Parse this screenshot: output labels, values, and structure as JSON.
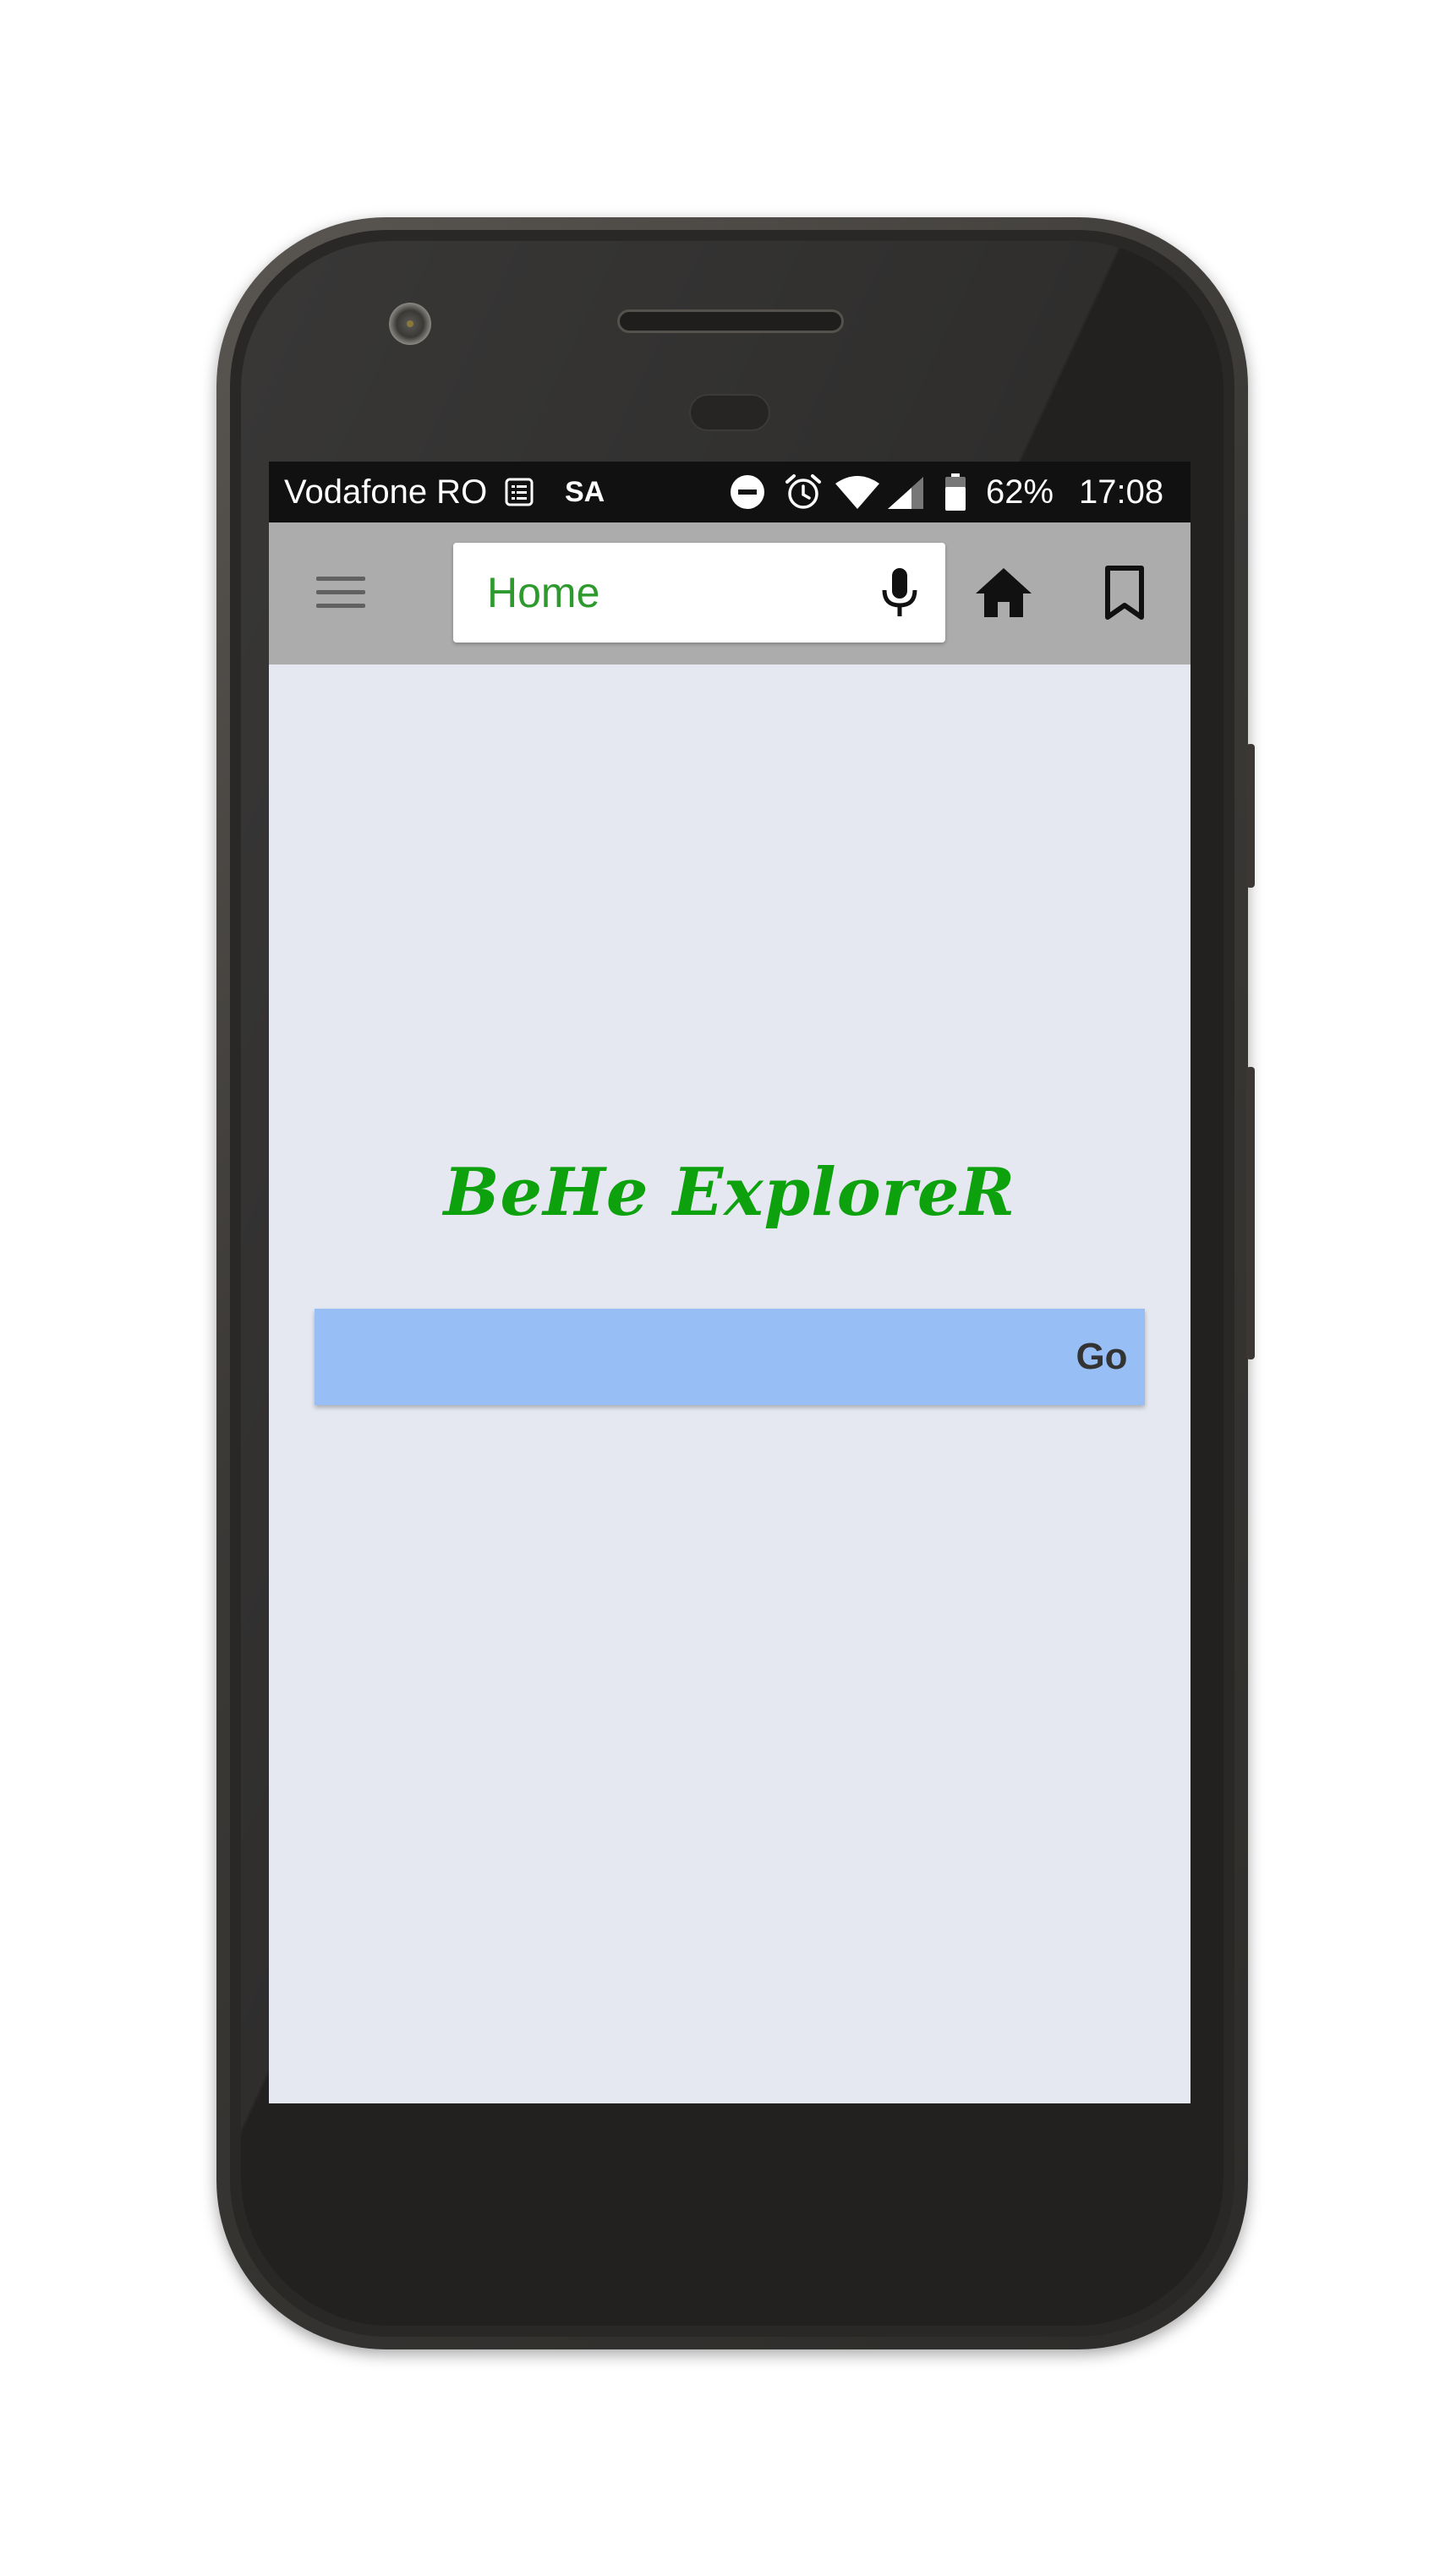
{
  "status_bar": {
    "carrier": "Vodafone RO",
    "sa_label": "SA",
    "battery": "62%",
    "time": "17:08",
    "icons": [
      "sim-list-icon",
      "dnd-icon",
      "alarm-icon",
      "wifi-icon",
      "signal-icon",
      "battery-icon"
    ]
  },
  "toolbar": {
    "menu_icon": "hamburger-menu-icon",
    "address": "Home",
    "mic_icon": "microphone-icon",
    "home_icon": "home-icon",
    "bookmark_icon": "bookmark-icon",
    "background": "#acacac",
    "address_color": "#2e9a2e"
  },
  "main": {
    "app_title": "BeHe ExploreR",
    "title_color": "#0ea10e",
    "search_value": "",
    "search_placeholder": "",
    "go_label": "Go",
    "search_background": "#98bff5"
  },
  "colors": {
    "screen_background": "#e5e8f1",
    "status_bar": "#111111"
  }
}
